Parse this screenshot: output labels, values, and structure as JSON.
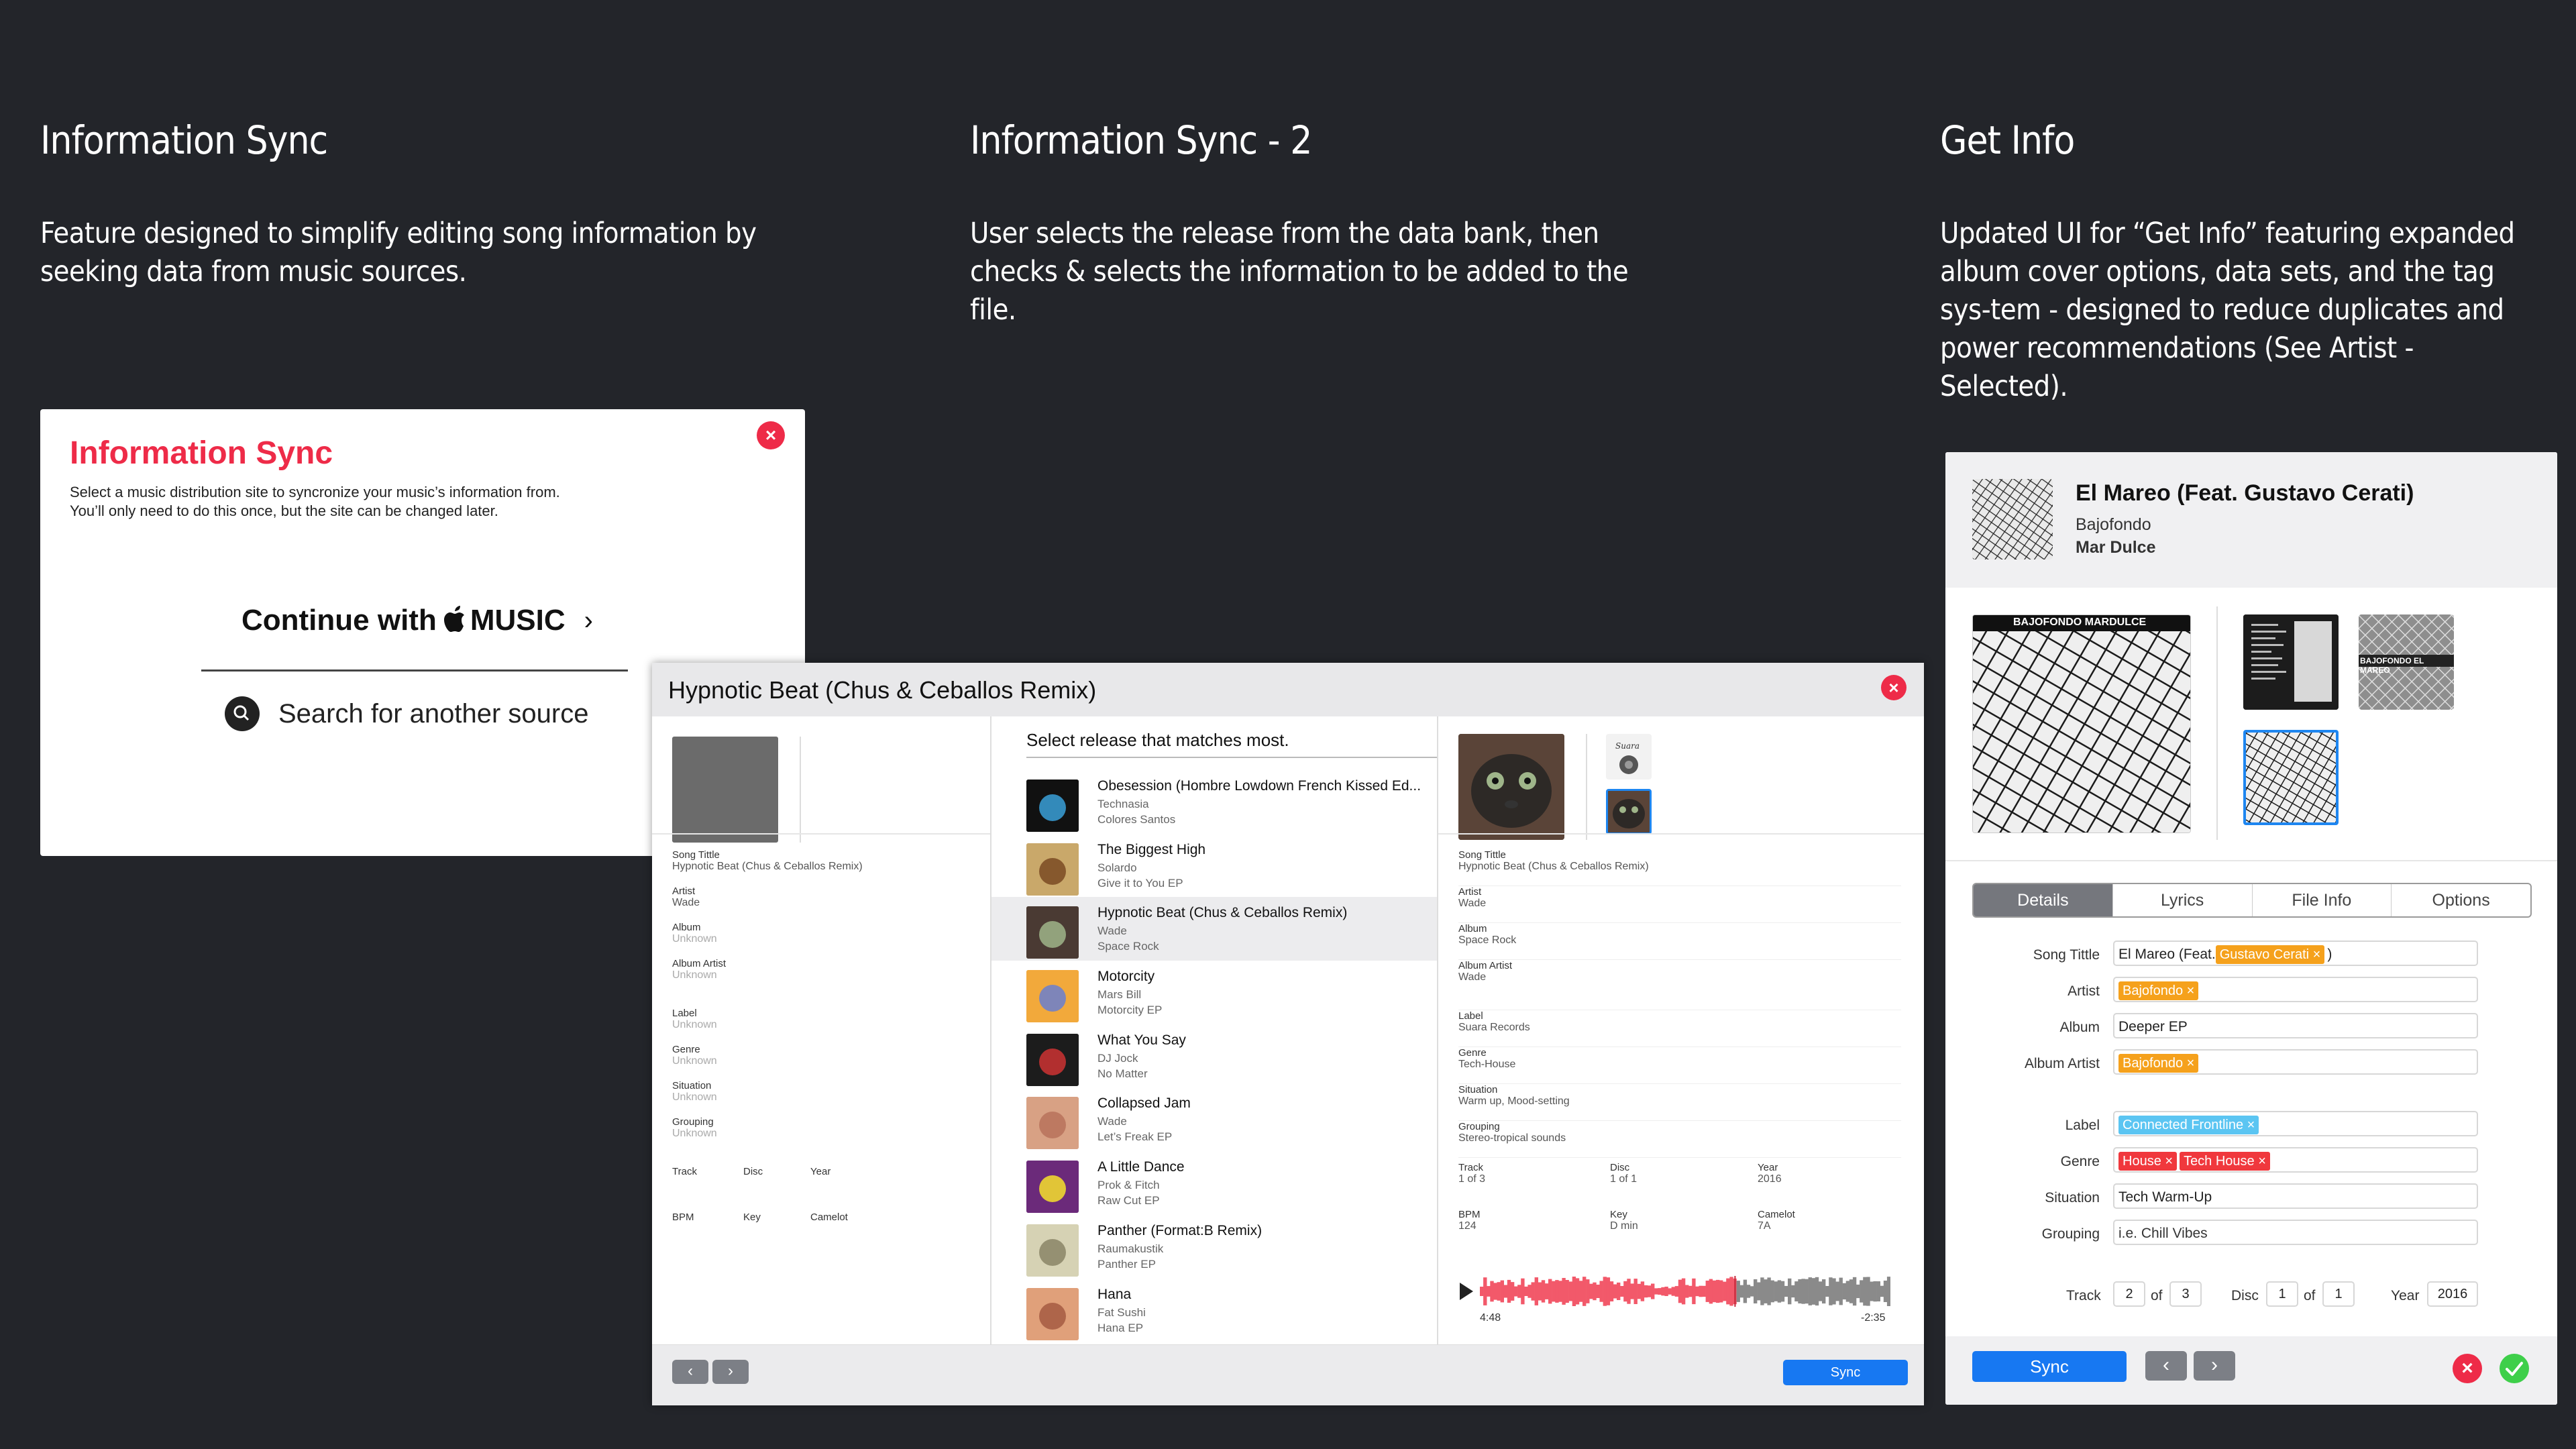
{
  "captions": [
    {
      "title": "Information Sync",
      "desc": "Feature designed to simplify editing song information by seeking data from music sources."
    },
    {
      "title": "Information Sync - 2",
      "desc": "User selects the release from the data bank, then checks & selects the information to be added to the file."
    },
    {
      "title": "Get Info",
      "desc": "Updated UI for “Get Info” featuring expanded album cover options, data sets, and the tag sys-tem - designed to reduce duplicates and power recommendations (See Artist - Selected)."
    }
  ],
  "sync_dialog": {
    "title": "Information Sync",
    "desc1": "Select a music distribution site to syncronize your music’s information from.",
    "desc2": "You’ll only need to do this once, but the site can be changed later.",
    "continue_label": "Continue with",
    "music_label": "MUSIC",
    "search_label": "Search for another source"
  },
  "sync2": {
    "title": "Hypnotic Beat (Chus & Ceballos Remix)",
    "left_fields": [
      {
        "label": "Song Tittle",
        "value": "Hypnotic Beat (Chus & Ceballos Remix)"
      },
      {
        "label": "Artist",
        "value": "Wade"
      },
      {
        "label": "Album",
        "value": "Unknown"
      },
      {
        "label": "Album Artist",
        "value": "Unknown"
      },
      {
        "label": "Label",
        "value": "Unknown"
      },
      {
        "label": "Genre",
        "value": "Unknown"
      },
      {
        "label": "Situation",
        "value": "Unknown"
      },
      {
        "label": "Grouping",
        "value": "Unknown"
      }
    ],
    "left_grid": [
      "Track",
      "Disc",
      "Year",
      "BPM",
      "Key",
      "Camelot"
    ],
    "list_header": "Select release that matches most.",
    "releases": [
      {
        "title": "Obesession (Hombre Lowdown French Kissed Ed...",
        "artist": "Technasia",
        "album": "Colores Santos"
      },
      {
        "title": "The Biggest High",
        "artist": "Solardo",
        "album": "Give it to You EP"
      },
      {
        "title": "Hypnotic Beat (Chus & Ceballos Remix)",
        "artist": "Wade",
        "album": "Space Rock"
      },
      {
        "title": "Motorcity",
        "artist": "Mars Bill",
        "album": "Motorcity EP"
      },
      {
        "title": "What You Say",
        "artist": "DJ Jock",
        "album": "No Matter"
      },
      {
        "title": "Collapsed Jam",
        "artist": "Wade",
        "album": "Let’s Freak EP"
      },
      {
        "title": "A Little Dance",
        "artist": "Prok & Fitch",
        "album": "Raw Cut EP"
      },
      {
        "title": "Panther (Format:B Remix)",
        "artist": "Raumakustik",
        "album": "Panther EP"
      },
      {
        "title": "Hana",
        "artist": "Fat Sushi",
        "album": "Hana EP"
      }
    ],
    "right_fields": [
      {
        "label": "Song Tittle",
        "value": "Hypnotic Beat (Chus & Ceballos Remix)"
      },
      {
        "label": "Artist",
        "value": "Wade"
      },
      {
        "label": "Album",
        "value": "Space Rock"
      },
      {
        "label": "Album Artist",
        "value": "Wade"
      },
      {
        "label": "Label",
        "value": "Suara Records"
      },
      {
        "label": "Genre",
        "value": "Tech-House"
      },
      {
        "label": "Situation",
        "value": "Warm up, Mood-setting"
      },
      {
        "label": "Grouping",
        "value": "Stereo-tropical sounds"
      }
    ],
    "right_grid": [
      {
        "label": "Track",
        "value": "1 of 3"
      },
      {
        "label": "Disc",
        "value": "1 of 1"
      },
      {
        "label": "Year",
        "value": "2016"
      },
      {
        "label": "BPM",
        "value": "124"
      },
      {
        "label": "Key",
        "value": "D min"
      },
      {
        "label": "Camelot",
        "value": "7A"
      }
    ],
    "time_elapsed": "4:48",
    "time_remaining": "-2:35",
    "playback_progress": 0.62,
    "sync_label": "Sync"
  },
  "get_info": {
    "title": "El Mareo (Feat. Gustavo Cerati)",
    "artist": "Bajofondo",
    "album": "Mar Dulce",
    "cover_text_1": "BAJOFONDO MARDULCE",
    "cover_text_2": "BAJOFONDO EL MAREO",
    "tabs": [
      "Details",
      "Lyrics",
      "File Info",
      "Options"
    ],
    "active_tab": "Details",
    "fields": {
      "song_title_label": "Song Tittle",
      "song_title_prefix": "El Mareo (Feat.",
      "song_title_tag": "Gustavo Cerati",
      "song_title_suffix": ")",
      "artist_label": "Artist",
      "artist_tag": "Bajofondo",
      "album_label": "Album",
      "album_value": "Deeper EP",
      "album_artist_label": "Album Artist",
      "album_artist_tag": "Bajofondo",
      "label_label": "Label",
      "label_tag": "Connected Frontline",
      "genre_label": "Genre",
      "genre_tag1": "House",
      "genre_tag2": "Tech House",
      "situation_label": "Situation",
      "situation_value": "Tech Warm-Up",
      "grouping_label": "Grouping",
      "grouping_placeholder": "i.e. Chill Vibes"
    },
    "track_label": "Track",
    "track": "2",
    "of_label": "of",
    "track_total": "3",
    "disc_label": "Disc",
    "disc": "1",
    "disc_total": "1",
    "year_label": "Year",
    "year": "2016",
    "sync_label": "Sync",
    "tag_remove": "×",
    "colors": {
      "accent_red": "#ee2b48",
      "accent_blue": "#1778f2",
      "tag_orange": "#f5a11c",
      "tag_blue": "#5bc5f2",
      "tag_red": "#f0383d",
      "confirm_green": "#3ecf4a"
    }
  }
}
